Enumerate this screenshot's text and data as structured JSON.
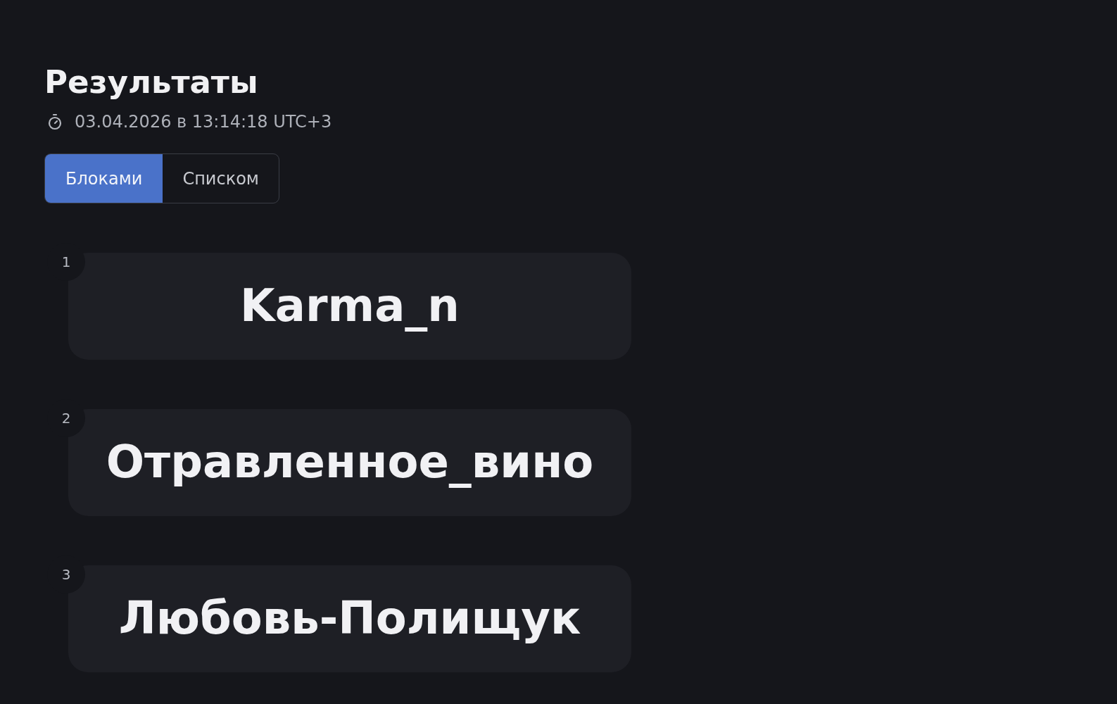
{
  "header": {
    "title": "Результаты",
    "timestamp": "03.04.2026 в 13:14:18 UTC+3"
  },
  "view_tabs": [
    {
      "label": "Блоками",
      "selected": true
    },
    {
      "label": "Списком",
      "selected": false
    }
  ],
  "results": [
    {
      "rank": "1",
      "name": "Karma_n"
    },
    {
      "rank": "2",
      "name": "Отравленное_вино"
    },
    {
      "rank": "3",
      "name": "Любовь-Полищук"
    }
  ]
}
